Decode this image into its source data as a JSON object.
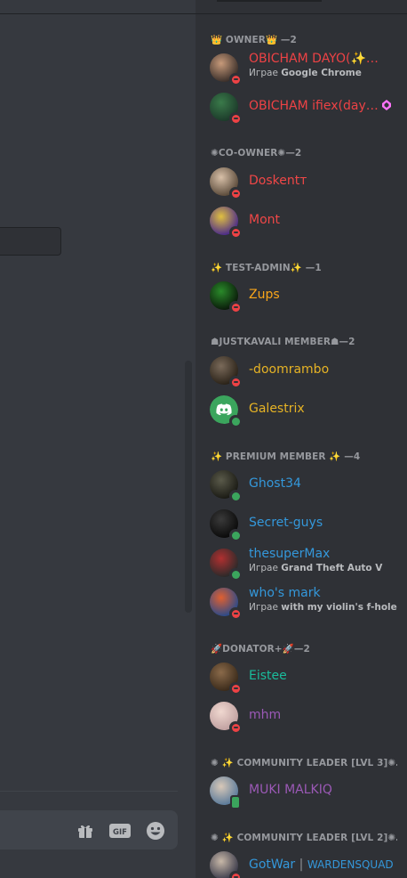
{
  "composer": {
    "gift_icon": "gift-icon",
    "gif_label": "GIF",
    "emoji_icon": "emoji-icon"
  },
  "members": {
    "sections": [
      {
        "label": "👑 OWNER👑 —2"
      },
      {
        "label": "✺CO-OWNER✺—2"
      },
      {
        "label": "✨ TEST-ADMIN✨ —1"
      },
      {
        "label": "☗JUSTKAVALI MEMBER☗—2"
      },
      {
        "label": "✨ PREMIUM MEMBER ✨ —4"
      },
      {
        "label": "🚀DONATOR+🚀—2"
      },
      {
        "label": "✺ ✨ COMMUNITY LEADER [LVL 3]✺…"
      },
      {
        "label": "✺ ✨ COMMUNITY LEADER [LVL 2]✺…"
      }
    ],
    "rows": [
      {
        "name": "OBICHAM DAYO(✨…",
        "color": "#ed4245",
        "status": "dnd",
        "activity_prefix": "Играе ",
        "activity": "Google Chrome",
        "avatar": [
          "#3a2f2a",
          "#c79a7a"
        ]
      },
      {
        "name": "OBICHAM ifiex(day…",
        "color": "#ed4245",
        "status": "dnd",
        "booster": true,
        "avatar": [
          "#1c3a2a",
          "#3a7a4a"
        ]
      },
      {
        "name": "Doskentт",
        "color": "#f04747",
        "status": "dnd",
        "avatar": [
          "#5a4a3a",
          "#d8c0a8"
        ]
      },
      {
        "name": "Mont",
        "color": "#f04747",
        "status": "dnd",
        "avatar": [
          "#4a2a8a",
          "#e0c040"
        ]
      },
      {
        "name": "Zups",
        "color": "#faa61a",
        "status": "dnd",
        "avatar": [
          "#0a1a0a",
          "#2a8a2a"
        ]
      },
      {
        "name": "-doomrambo",
        "color": "#e6b325",
        "status": "dnd",
        "avatar": [
          "#2a2218",
          "#7a6a5a"
        ]
      },
      {
        "name": "Galestrix",
        "color": "#e6b325",
        "status": "on",
        "avatar": [
          "#3ba55d",
          "#3ba55d"
        ],
        "discord_logo": true
      },
      {
        "name": "Ghost34",
        "color": "#3498db",
        "status": "on",
        "avatar": [
          "#1a1a14",
          "#5a5a4a"
        ]
      },
      {
        "name": "Secret-guys",
        "color": "#3498db",
        "status": "on",
        "avatar": [
          "#0a0a0a",
          "#3a3a3a"
        ]
      },
      {
        "name": "thesuperMax",
        "color": "#3498db",
        "status": "on",
        "activity_prefix": "Играе ",
        "activity": "Grand Theft Auto V",
        "avatar": [
          "#2a2a2a",
          "#b03030"
        ]
      },
      {
        "name": "who's mark",
        "color": "#3498db",
        "status": "dnd",
        "activity_prefix": "Играе ",
        "activity": "with my violin's f-hole",
        "avatar": [
          "#2a4a8a",
          "#e06030"
        ]
      },
      {
        "name": "Eistee",
        "color": "#1abc9c",
        "status": "dnd",
        "avatar": [
          "#3a2a1a",
          "#8a6a4a"
        ]
      },
      {
        "name": "mhm",
        "color": "#9b59b6",
        "status": "dnd",
        "avatar": [
          "#c0a0a0",
          "#f0d8d0"
        ]
      },
      {
        "name": "MUKI MALKIQ",
        "color": "#9b59b6",
        "status": "mob",
        "avatar": [
          "#5a7a9a",
          "#d8c8b8"
        ]
      },
      {
        "name": "GotWar",
        "name_sep": " | ",
        "name_tag": "WARDENSQUAD",
        "color": "#3498db",
        "status": "dnd",
        "avatar": [
          "#3a3a4a",
          "#c8b8a8"
        ]
      }
    ]
  }
}
